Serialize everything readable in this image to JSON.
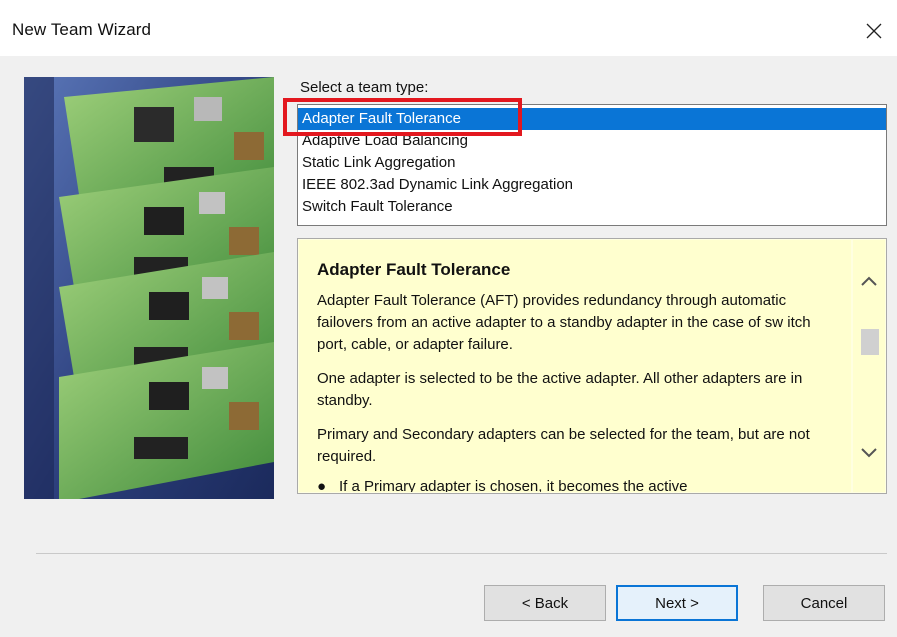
{
  "window": {
    "title": "New Team Wizard",
    "close_icon": "close-icon"
  },
  "team_type": {
    "label": "Select a team type:",
    "options": [
      "Adapter Fault Tolerance",
      "Adaptive Load Balancing",
      "Static Link Aggregation",
      "IEEE 802.3ad Dynamic Link Aggregation",
      "Switch Fault Tolerance"
    ],
    "selected": "Adapter Fault Tolerance"
  },
  "description": {
    "title": "Adapter Fault Tolerance",
    "paragraphs": [
      "Adapter Fault Tolerance (AFT) provides redundancy through automatic failovers from an active adapter to a standby adapter in the case of sw itch port, cable, or adapter failure.",
      "One adapter is selected to be the active adapter. All other adapters are in standby.",
      "Primary and Secondary adapters can be selected for the team, but are not required."
    ],
    "bullet": "If a Primary adapter is chosen, it becomes the active"
  },
  "buttons": {
    "back": "< Back",
    "next": "Next >",
    "cancel": "Cancel"
  },
  "colors": {
    "selection": "#0a75d6",
    "highlight_box": "#e3181f",
    "description_bg": "#ffffcf"
  }
}
